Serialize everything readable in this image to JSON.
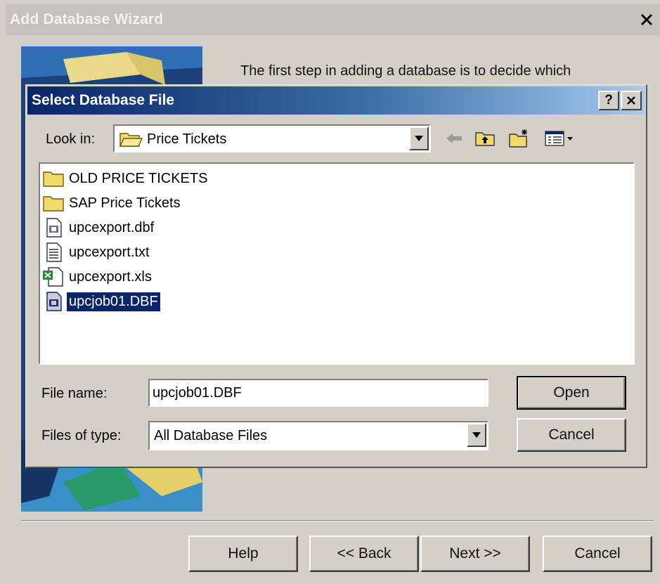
{
  "wizard": {
    "title": "Add Database Wizard",
    "intro_text": "The first step in adding a database is to decide which",
    "buttons": {
      "help": "Help",
      "back": "<< Back",
      "next": "Next >>",
      "cancel": "Cancel"
    }
  },
  "dialog": {
    "title": "Select Database File",
    "help_button": "?",
    "look_in_label": "Look in:",
    "look_in_value": "Price Tickets",
    "toolbar_icons": [
      "back-arrow-icon",
      "up-one-level-icon",
      "new-folder-icon",
      "view-menu-icon"
    ],
    "files": [
      {
        "name": "OLD PRICE TICKETS",
        "icon": "folder-icon",
        "selected": false
      },
      {
        "name": "SAP Price Tickets",
        "icon": "folder-icon",
        "selected": false
      },
      {
        "name": "upcexport.dbf",
        "icon": "dbf-file-icon",
        "selected": false
      },
      {
        "name": "upcexport.txt",
        "icon": "text-file-icon",
        "selected": false
      },
      {
        "name": "upcexport.xls",
        "icon": "excel-file-icon",
        "selected": false
      },
      {
        "name": "upcjob01.DBF",
        "icon": "dbf-file-icon",
        "selected": true
      }
    ],
    "file_name_label": "File name:",
    "file_name_value": "upcjob01.DBF",
    "files_of_type_label": "Files of type:",
    "files_of_type_value": "All Database Files",
    "open_button": "Open",
    "cancel_button": "Cancel"
  }
}
